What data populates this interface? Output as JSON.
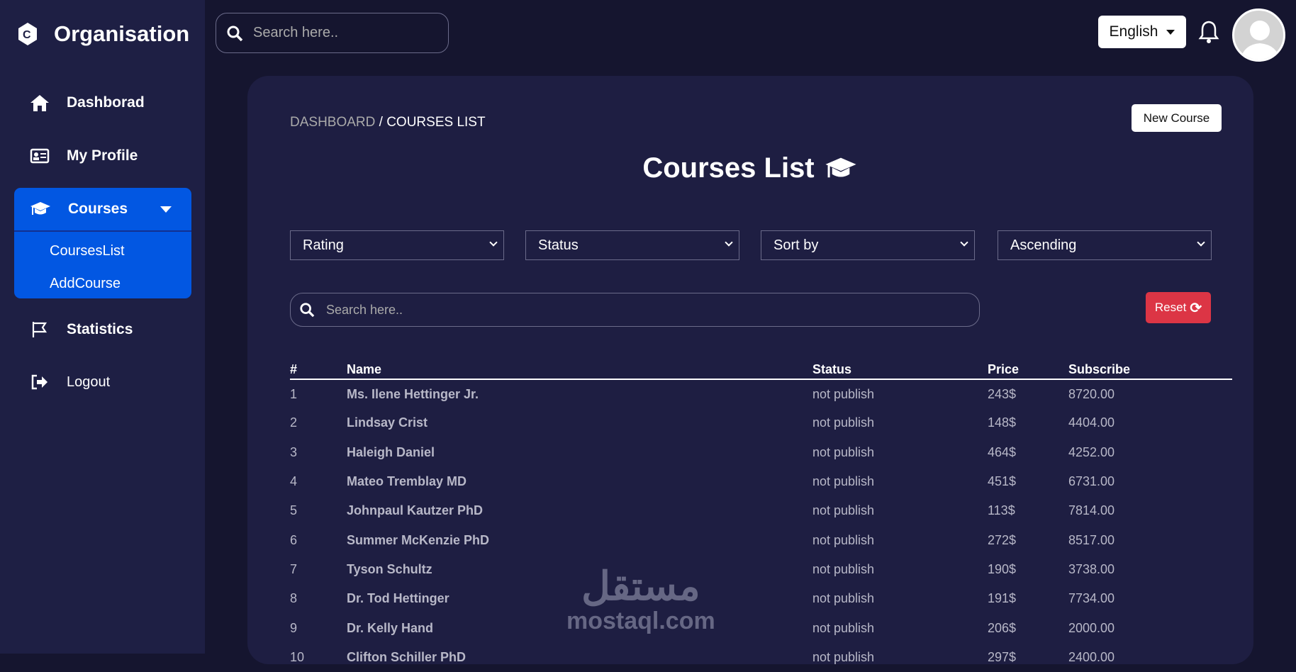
{
  "sidebar": {
    "brand": "Organisation",
    "items": [
      {
        "label": "Dashborad"
      },
      {
        "label": "My Profile"
      },
      {
        "label": "Courses"
      },
      {
        "label": "Statistics"
      },
      {
        "label": "Logout"
      }
    ],
    "courses_sub": [
      {
        "label": "CoursesList"
      },
      {
        "label": "AddCourse"
      }
    ]
  },
  "topbar": {
    "search_placeholder": "Search here..",
    "language": "English"
  },
  "breadcrumb": {
    "root": "DASHBOARD",
    "sep": "/",
    "current": "COURSES LIST"
  },
  "new_course": "New Course",
  "title": "Courses List",
  "filters": [
    "Rating",
    "Status",
    "Sort by",
    "Ascending"
  ],
  "search_placeholder": "Search here..",
  "reset": "Reset",
  "table": {
    "headers": [
      "#",
      "Name",
      "Status",
      "Price",
      "Subscribe"
    ],
    "rows": [
      [
        "1",
        "Ms. Ilene Hettinger Jr.",
        "not publish",
        "243$",
        "8720.00"
      ],
      [
        "2",
        "Lindsay Crist",
        "not publish",
        "148$",
        "4404.00"
      ],
      [
        "3",
        "Haleigh Daniel",
        "not publish",
        "464$",
        "4252.00"
      ],
      [
        "4",
        "Mateo Tremblay MD",
        "not publish",
        "451$",
        "6731.00"
      ],
      [
        "5",
        "Johnpaul Kautzer PhD",
        "not publish",
        "113$",
        "7814.00"
      ],
      [
        "6",
        "Summer McKenzie PhD",
        "not publish",
        "272$",
        "8517.00"
      ],
      [
        "7",
        "Tyson Schultz",
        "not publish",
        "190$",
        "3738.00"
      ],
      [
        "8",
        "Dr. Tod Hettinger",
        "not publish",
        "191$",
        "7734.00"
      ],
      [
        "9",
        "Dr. Kelly Hand",
        "not publish",
        "206$",
        "2000.00"
      ],
      [
        "10",
        "Clifton Schiller PhD",
        "not publish",
        "297$",
        "2400.00"
      ]
    ]
  },
  "watermark": {
    "arabic": "مستقل",
    "latin": "mostaql.com"
  },
  "colors": {
    "active": "#0257e2",
    "reset": "#dc3545"
  }
}
